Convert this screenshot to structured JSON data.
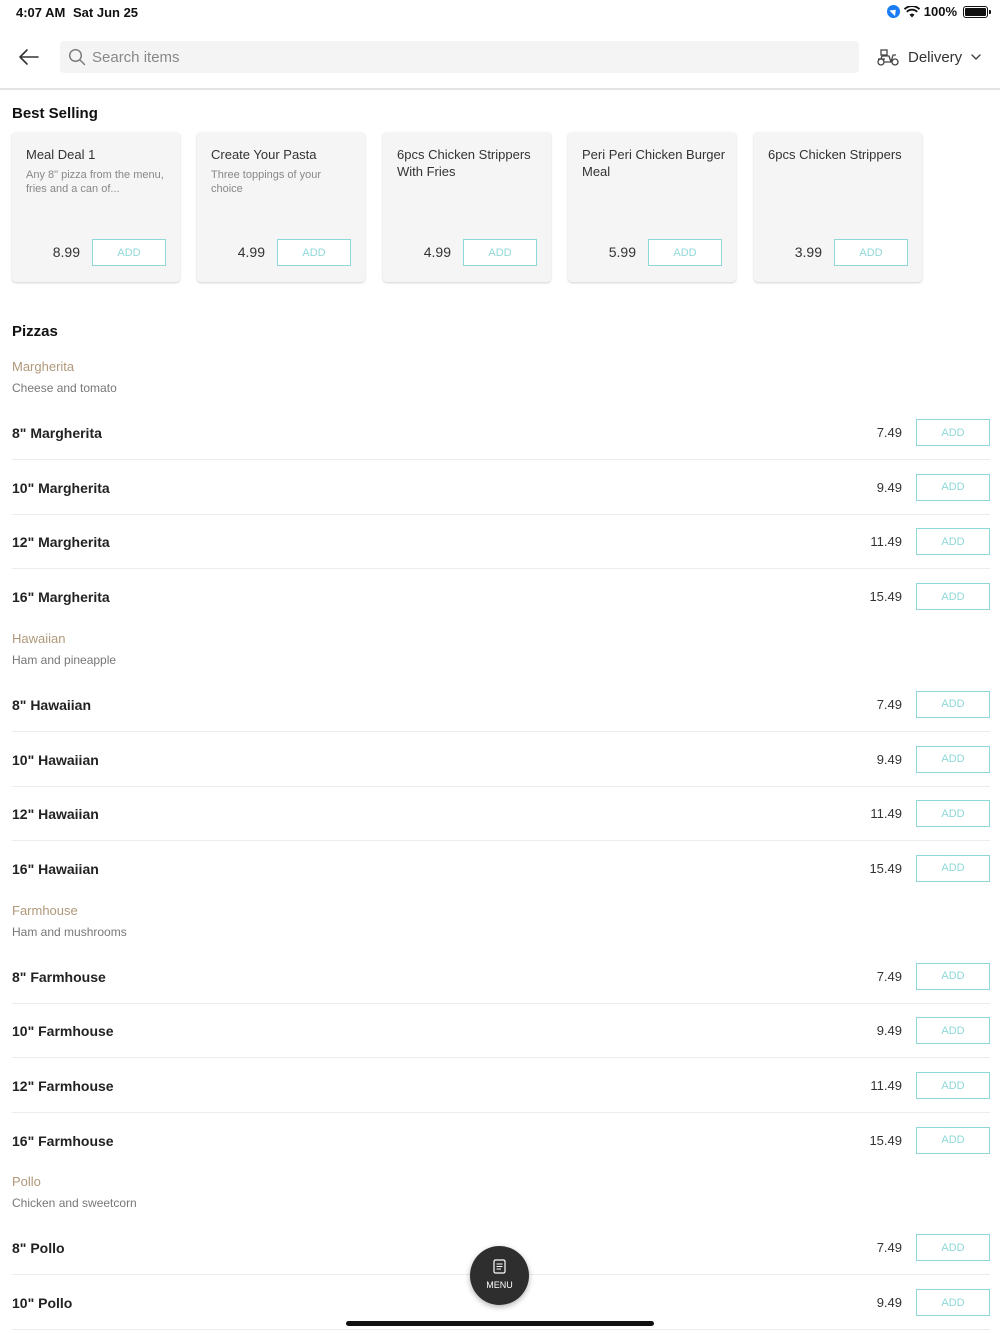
{
  "status_bar": {
    "time": "4:07 AM",
    "date": "Sat Jun 25",
    "battery": "100%"
  },
  "header": {
    "search_placeholder": "Search items",
    "delivery_label": "Delivery"
  },
  "best_selling": {
    "title": "Best Selling",
    "items": [
      {
        "name": "Meal Deal 1",
        "description": "Any 8\" pizza from the menu, fries and a can of...",
        "price": "8.99",
        "add_label": "ADD"
      },
      {
        "name": "Create Your Pasta",
        "description": "Three toppings of your choice",
        "price": "4.99",
        "add_label": "ADD"
      },
      {
        "name": "6pcs Chicken Strippers With Fries",
        "description": "",
        "price": "4.99",
        "add_label": "ADD"
      },
      {
        "name": "Peri Peri Chicken Burger Meal",
        "description": "",
        "price": "5.99",
        "add_label": "ADD"
      },
      {
        "name": "6pcs Chicken Strippers",
        "description": "",
        "price": "3.99",
        "add_label": "ADD"
      }
    ]
  },
  "pizzas": {
    "title": "Pizzas",
    "groups": [
      {
        "name": "Margherita",
        "description": "Cheese and tomato",
        "items": [
          {
            "name": "8\" Margherita",
            "price": "7.49",
            "add_label": "ADD"
          },
          {
            "name": "10\" Margherita",
            "price": "9.49",
            "add_label": "ADD"
          },
          {
            "name": "12\" Margherita",
            "price": "11.49",
            "add_label": "ADD"
          },
          {
            "name": "16\" Margherita",
            "price": "15.49",
            "add_label": "ADD"
          }
        ]
      },
      {
        "name": "Hawaiian",
        "description": "Ham and pineapple",
        "items": [
          {
            "name": "8\" Hawaiian",
            "price": "7.49",
            "add_label": "ADD"
          },
          {
            "name": "10\" Hawaiian",
            "price": "9.49",
            "add_label": "ADD"
          },
          {
            "name": "12\" Hawaiian",
            "price": "11.49",
            "add_label": "ADD"
          },
          {
            "name": "16\" Hawaiian",
            "price": "15.49",
            "add_label": "ADD"
          }
        ]
      },
      {
        "name": "Farmhouse",
        "description": "Ham and mushrooms",
        "items": [
          {
            "name": "8\" Farmhouse",
            "price": "7.49",
            "add_label": "ADD"
          },
          {
            "name": "10\" Farmhouse",
            "price": "9.49",
            "add_label": "ADD"
          },
          {
            "name": "12\" Farmhouse",
            "price": "11.49",
            "add_label": "ADD"
          },
          {
            "name": "16\" Farmhouse",
            "price": "15.49",
            "add_label": "ADD"
          }
        ]
      },
      {
        "name": "Pollo",
        "description": "Chicken and sweetcorn",
        "items": [
          {
            "name": "8\" Pollo",
            "price": "7.49",
            "add_label": "ADD"
          },
          {
            "name": "10\" Pollo",
            "price": "9.49",
            "add_label": "ADD"
          }
        ]
      }
    ]
  },
  "menu_button": {
    "label": "MENU",
    "icon": "menu-list-icon"
  },
  "colors": {
    "accent": "#8fd8d8",
    "group_name": "#b0987a",
    "fab": "#2e2e2e"
  }
}
